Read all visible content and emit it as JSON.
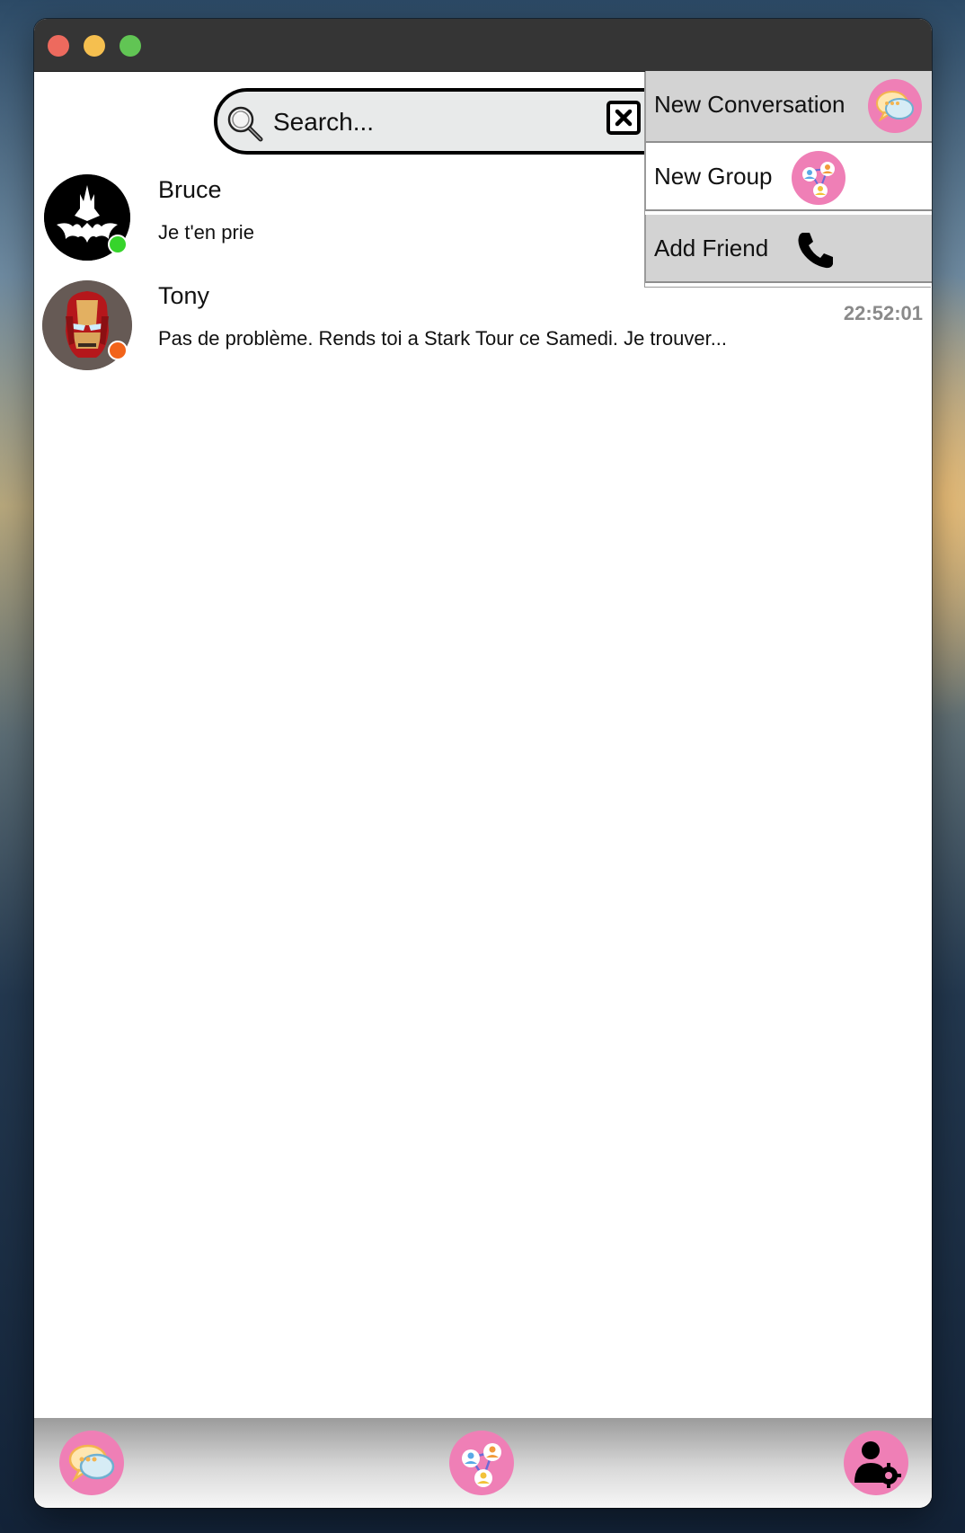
{
  "window": {
    "traffic_lights": [
      "close",
      "minimize",
      "maximize"
    ]
  },
  "search": {
    "placeholder": "Search...",
    "icon": "magnifier-icon",
    "clear_icon": "close-box-icon"
  },
  "conversations": [
    {
      "name": "Bruce",
      "last_message": "Je t'en prie",
      "time": "",
      "status": "online",
      "status_color": "#36d42b",
      "avatar": "batman-avatar"
    },
    {
      "name": "Tony",
      "last_message": "Pas de problème. Rends toi a Stark Tour ce Samedi. Je trouver...",
      "time": "22:52:01",
      "status": "away",
      "status_color": "#f2631a",
      "avatar": "ironman-avatar"
    }
  ],
  "menu": {
    "items": [
      {
        "label": "New Conversation",
        "icon": "chat-bubbles-icon"
      },
      {
        "label": "New Group",
        "icon": "group-network-icon"
      },
      {
        "label": "Add Friend",
        "icon": "phone-icon"
      }
    ]
  },
  "bottom_bar": {
    "items": [
      "chat-bubbles-icon",
      "group-network-icon",
      "user-settings-icon"
    ]
  },
  "colors": {
    "accent_pink": "#ef7fb6",
    "online": "#36d42b",
    "away": "#f2631a",
    "menu_grey": "#d3d3d3",
    "time_grey": "#8a8a8a"
  }
}
